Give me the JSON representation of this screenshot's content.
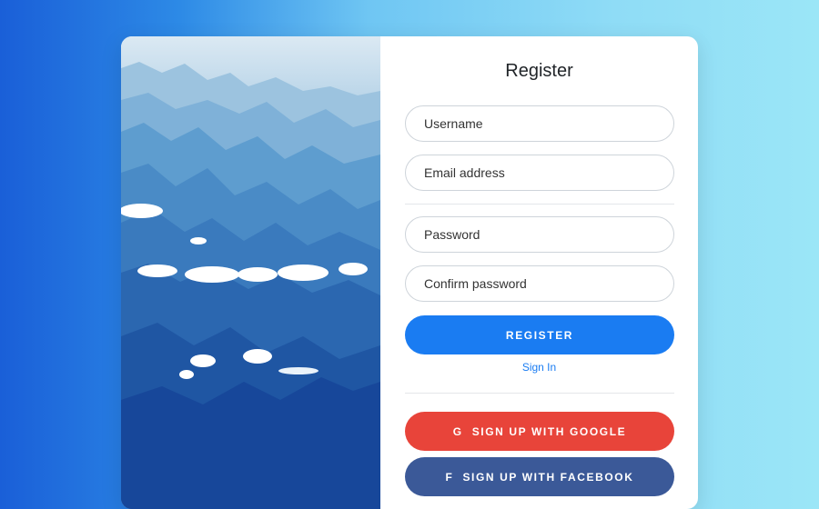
{
  "form": {
    "title": "Register",
    "username_placeholder": "Username",
    "email_placeholder": "Email address",
    "password_placeholder": "Password",
    "confirm_password_placeholder": "Confirm password",
    "register_label": "REGISTER",
    "signin_label": "Sign In",
    "google_label": "SIGN UP WITH GOOGLE",
    "facebook_label": "SIGN UP WITH FACEBOOK",
    "google_icon_glyph": "G",
    "facebook_icon_glyph": "f"
  },
  "colors": {
    "primary": "#1a7cf2",
    "google": "#e8443a",
    "facebook": "#3b5998"
  },
  "icons": [
    "google-icon",
    "facebook-icon"
  ]
}
